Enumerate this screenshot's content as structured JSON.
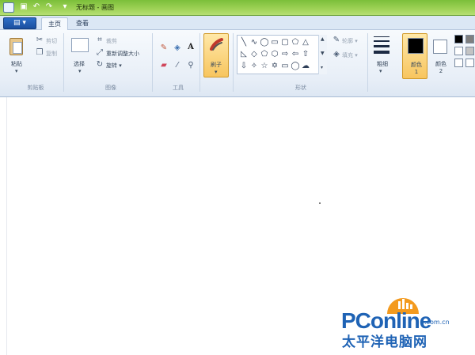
{
  "titlebar": {
    "title": "无标题 - 画图",
    "quick_access": [
      "save-icon",
      "undo-icon",
      "redo-icon",
      "customize-icon"
    ]
  },
  "tabs": [
    {
      "label": "主页",
      "active": true
    },
    {
      "label": "查看",
      "active": false
    }
  ],
  "ribbon": {
    "clipboard": {
      "label": "剪贴板",
      "paste": "粘贴",
      "cut": "剪切",
      "copy": "复制"
    },
    "image": {
      "label": "图像",
      "select": "选择",
      "crop": "裁剪",
      "resize": "重新调整大小",
      "rotate": "旋转 ▾"
    },
    "tools": {
      "label": "工具"
    },
    "brushes": {
      "label": "刷子"
    },
    "shapes": {
      "label": "形状",
      "outline": "轮廓 ▾",
      "fill": "填充 ▾"
    },
    "size": {
      "label": "粗细"
    },
    "color1": {
      "label": "颜色 1",
      "value": "#000000"
    },
    "color2": {
      "label": "颜色 2",
      "value": "#ffffff"
    }
  },
  "colors": {
    "accent_green": "#9fd257",
    "ribbon_bg": "#e7eef7",
    "highlight": "#f7c55f"
  },
  "watermark": {
    "title": "PConline",
    "domain": ".com.cn",
    "subtitle": "太平洋电脑网"
  }
}
